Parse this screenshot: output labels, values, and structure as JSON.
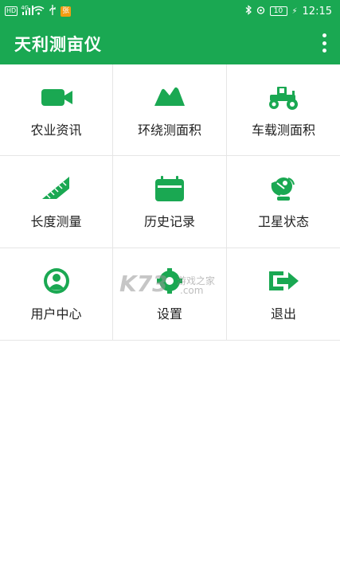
{
  "status_bar": {
    "network_badge": "HD",
    "signal_text": "4G",
    "app_badge": "张",
    "battery_level": "10",
    "time": "12:15"
  },
  "app_bar": {
    "title": "天利测亩仪"
  },
  "menu": [
    {
      "label": "农业资讯",
      "icon": "video-camera-icon"
    },
    {
      "label": "环绕测面积",
      "icon": "mountain-icon"
    },
    {
      "label": "车载测面积",
      "icon": "tractor-icon"
    },
    {
      "label": "长度测量",
      "icon": "ruler-icon"
    },
    {
      "label": "历史记录",
      "icon": "calendar-icon"
    },
    {
      "label": "卫星状态",
      "icon": "satellite-dish-icon"
    },
    {
      "label": "用户中心",
      "icon": "user-icon"
    },
    {
      "label": "设置",
      "icon": "gear-icon"
    },
    {
      "label": "退出",
      "icon": "exit-icon"
    }
  ],
  "watermark": {
    "text_a": "K73",
    "text_b": "游戏之家",
    "text_c": ".com"
  },
  "colors": {
    "primary": "#1aa852",
    "icon": "#1aa852",
    "text": "#222222",
    "divider": "#e6e6e6"
  }
}
